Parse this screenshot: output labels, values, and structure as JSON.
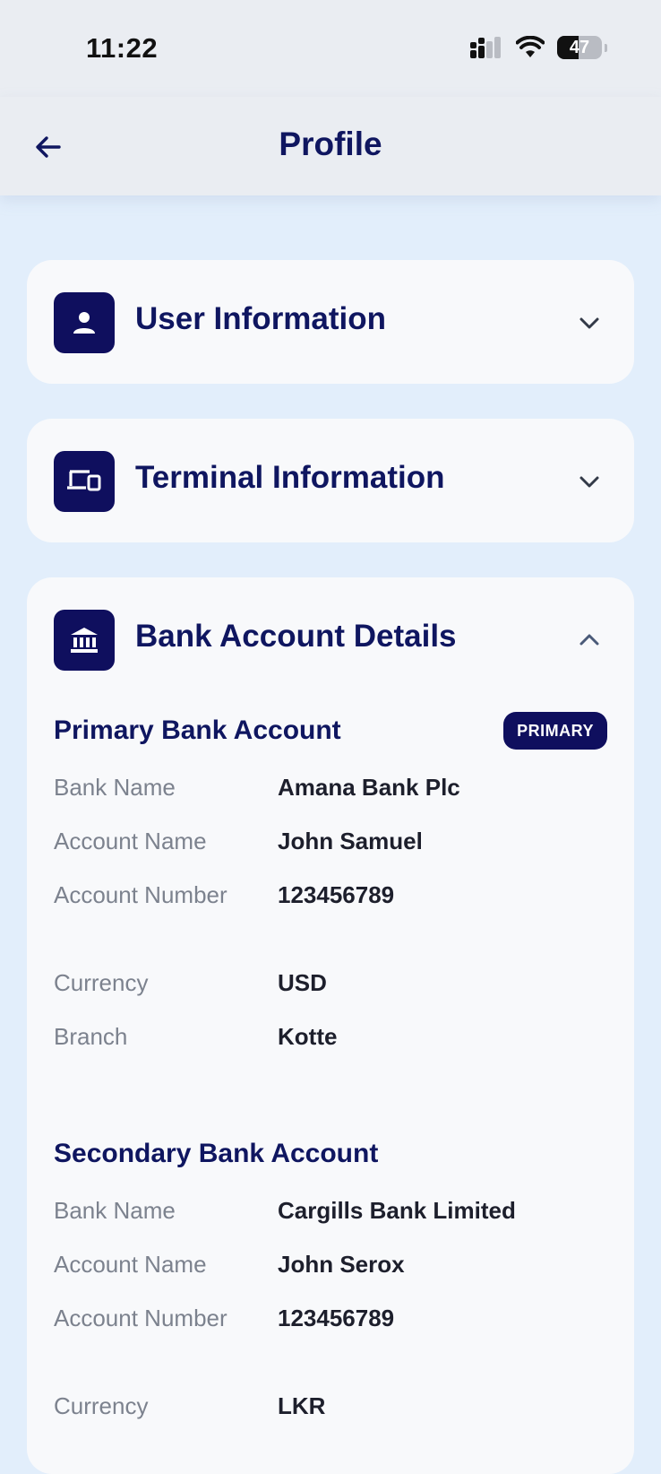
{
  "status_bar": {
    "time": "11:22",
    "battery_percent": 47,
    "icons": [
      "signal-icon",
      "wifi-icon",
      "battery-icon"
    ]
  },
  "header": {
    "title": "Profile",
    "back_icon": "arrow-left-icon"
  },
  "sections": {
    "user_info": {
      "title": "User Information",
      "icon": "person-icon",
      "expanded": false
    },
    "terminal_info": {
      "title": "Terminal Information",
      "icon": "devices-icon",
      "expanded": false
    },
    "bank_details": {
      "title": "Bank Account Details",
      "icon": "bank-icon",
      "expanded": true
    }
  },
  "primary_account": {
    "heading": "Primary Bank Account",
    "badge": "PRIMARY",
    "rows": [
      {
        "label": "Bank Name",
        "value": "Amana Bank Plc"
      },
      {
        "label": "Account Name",
        "value": "John Samuel"
      },
      {
        "label": "Account Number",
        "value": "123456789"
      },
      {
        "label": "Currency",
        "value": "USD"
      },
      {
        "label": "Branch",
        "value": "Kotte"
      }
    ]
  },
  "secondary_account": {
    "heading": "Secondary Bank Account",
    "rows": [
      {
        "label": "Bank Name",
        "value": "Cargills Bank Limited"
      },
      {
        "label": "Account Name",
        "value": "John Serox"
      },
      {
        "label": "Account Number",
        "value": "123456789"
      },
      {
        "label": "Currency",
        "value": "LKR"
      }
    ]
  },
  "colors": {
    "brand_navy": "#0f0f5e",
    "title_text": "#0f1660",
    "page_bg": "#e2eefb",
    "card_bg": "#f8f9fb",
    "label_gray": "#7c828e"
  }
}
